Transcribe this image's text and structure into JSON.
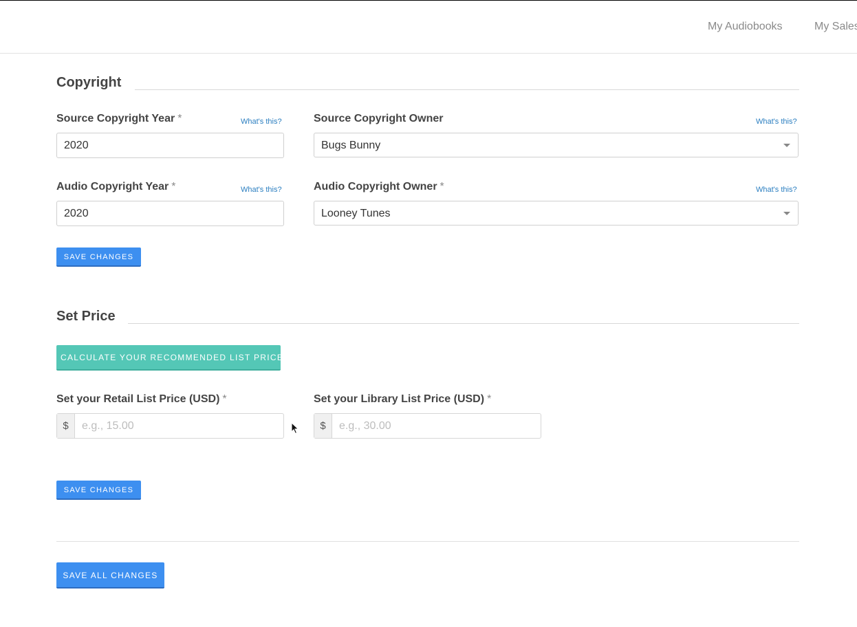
{
  "nav": {
    "my_audiobooks": "My Audiobooks",
    "my_sales": "My Sales"
  },
  "copyright": {
    "title": "Copyright",
    "source_year_label": "Source Copyright Year",
    "source_year_value": "2020",
    "source_owner_label": "Source Copyright Owner",
    "source_owner_value": "Bugs Bunny",
    "audio_year_label": "Audio Copyright Year",
    "audio_year_value": "2020",
    "audio_owner_label": "Audio Copyright Owner",
    "audio_owner_value": "Looney Tunes",
    "help_text": "What's this?",
    "required_mark": "*",
    "save_label": "SAVE CHANGES"
  },
  "price": {
    "title": "Set Price",
    "calculate_label": "CALCULATE YOUR RECOMMENDED LIST PRICE",
    "retail_label": "Set your Retail List Price (USD)",
    "retail_placeholder": "e.g., 15.00",
    "library_label": "Set your Library List Price (USD)",
    "library_placeholder": "e.g., 30.00",
    "currency_symbol": "$",
    "required_mark": "*",
    "save_label": "SAVE CHANGES"
  },
  "footer": {
    "save_all_label": "SAVE ALL CHANGES"
  },
  "colors": {
    "primary_button": "#3d8ff0",
    "teal_button": "#54c7b6",
    "link": "#2a7ec0"
  }
}
